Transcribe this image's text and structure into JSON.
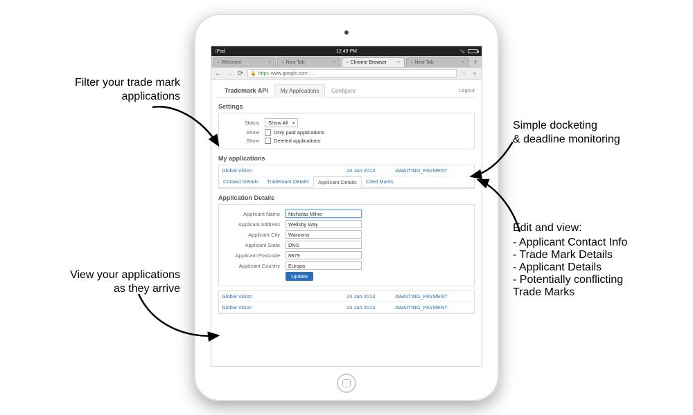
{
  "statusbar": {
    "carrier": "iPad",
    "wifi": "᯾",
    "time": "12:49 PM",
    "bt": "✱"
  },
  "browser": {
    "tabs": [
      "Welcome",
      "New Tab",
      "Chrome Browser",
      "New Tab"
    ],
    "active_tab_index": 2,
    "url_prefix": "https",
    "url_host": "www.google.com",
    "url_path": "/…"
  },
  "page": {
    "tabs": {
      "brand": "Trademark API",
      "my_apps": "My Applications",
      "configure": "Configure"
    },
    "logout": "Logout",
    "settings": {
      "title": "Settings",
      "status_label": "Status",
      "status_value": "Show All",
      "show_label": "Show",
      "only_paid": "Only paid applications",
      "deleted": "Deleted applications"
    },
    "my_apps": {
      "title": "My applications",
      "rows": [
        {
          "name": "Global Vision",
          "date": "24 Jan 2013",
          "status": "AWAITING_PAYMENT"
        }
      ],
      "subtabs": [
        "Contact Details",
        "Trademark Details",
        "Applicant Details",
        "Cited Marks"
      ],
      "active_subtab_index": 2
    },
    "details": {
      "title": "Application Details",
      "fields": {
        "name_label": "Applicant Name",
        "name_value": "Nicholas Milne",
        "address_label": "Applicant Address",
        "address_value": "Wellsby Way",
        "city_label": "Applicant City",
        "city_value": "Waroona",
        "state_label": "Applicant State",
        "state_value": "DNS",
        "postcode_label": "Applicant Postcode",
        "postcode_value": "8879",
        "country_label": "Applicant Country",
        "country_value": "Europa"
      },
      "update_btn": "Update"
    },
    "bottom_rows": [
      {
        "name": "Global Vision",
        "date": "24 Jan 2013",
        "status": "AWAITING_PAYMENT"
      },
      {
        "name": "Global Vision",
        "date": "24 Jan 2013",
        "status": "AWAITING_PAYMENT"
      }
    ]
  },
  "callouts": {
    "filter": "Filter your trade mark\napplications",
    "view": "View your applications\nas they arrive",
    "docket": "Simple docketing\n& deadline monitoring",
    "edit_title": "Edit and view:",
    "edit_items": [
      "Applicant Contact Info",
      "Trade Mark Details",
      "Applicant Details",
      "Potentially conflicting\n  Trade Marks"
    ]
  }
}
